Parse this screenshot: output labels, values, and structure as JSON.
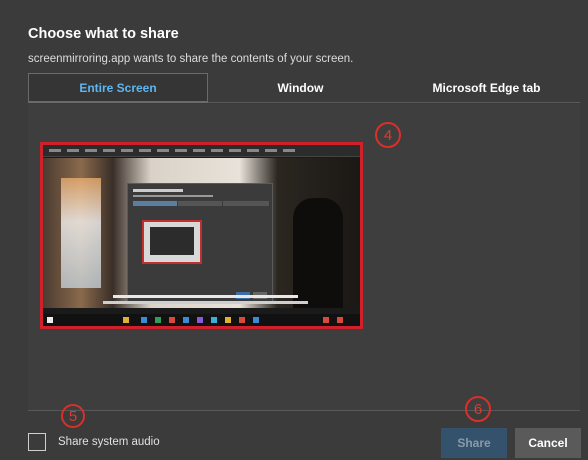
{
  "dialog": {
    "title": "Choose what to share",
    "subtitle": "screenmirroring.app wants to share the contents of your screen."
  },
  "tabs": [
    {
      "label": "Entire Screen",
      "active": true
    },
    {
      "label": "Window",
      "active": false
    },
    {
      "label": "Microsoft Edge tab",
      "active": false
    }
  ],
  "markers": {
    "four": "4",
    "five": "5",
    "six": "6"
  },
  "audio": {
    "label": "Share system audio",
    "checked": false
  },
  "buttons": {
    "share": "Share",
    "cancel": "Cancel"
  },
  "colors": {
    "accent": "#5eb6f0",
    "marker": "#d9302a",
    "share_disabled_bg": "#34526c"
  }
}
